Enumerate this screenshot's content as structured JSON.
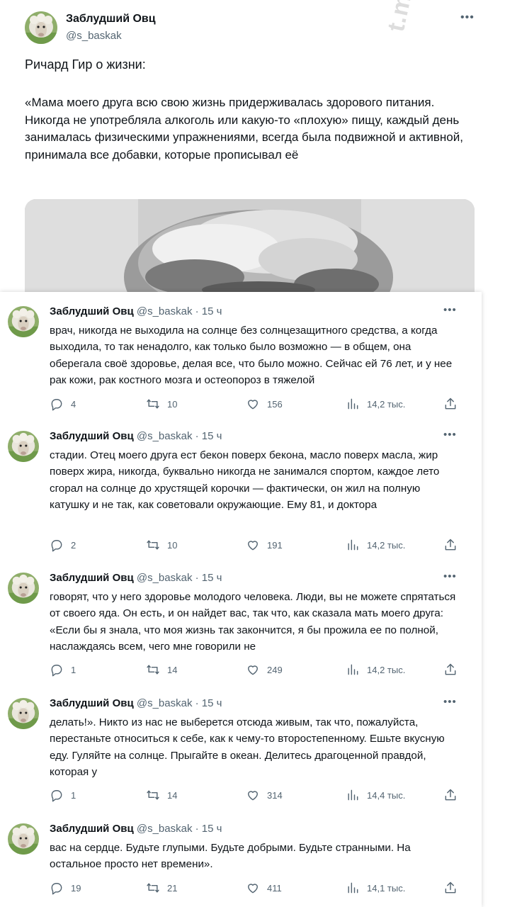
{
  "main_tweet": {
    "author_name": "Заблудший Овц",
    "author_handle": "@s_baskak",
    "more_label": "•••",
    "intro": "Ричард Гир о жизни:",
    "quote": "«Мама моего друга всю свою жизнь придерживалась здорового питания. Никогда не употребляла алкоголь или какую-то «плохую» пищу, каждый день занималась физическими упражнениями, всегда была подвижной и активной, принимала все добавки, которые прописывал её",
    "watermark": "t.me/veravatki"
  },
  "thread": [
    {
      "name": "Заблудший Овц",
      "handle": "@s_baskak",
      "time": "· 15 ч",
      "text": "врач, никогда не выходила на солнце без солнцезащитного средства, а когда выходила, то так ненадолго, как только было возможно — в общем, она оберегала своё здоровье, делая все, что было можно. Сейчас ей 76 лет, и у нее рак кожи, рак костного мозга и остеопороз в тяжелой",
      "replies": "4",
      "retweets": "10",
      "likes": "156",
      "views": "14,2 тыс."
    },
    {
      "name": "Заблудший Овц",
      "handle": "@s_baskak",
      "time": "· 15 ч",
      "text": "стадии. Отец моего друга ест бекон поверх бекона, масло поверх масла, жир поверх жира, никогда, буквально никогда не занимался спортом, каждое лето сгорал на солнце до хрустящей корочки — фактически, он жил на полную катушку и не так, как советовали окружающие. Ему 81, и доктора",
      "replies": "2",
      "retweets": "10",
      "likes": "191",
      "views": "14,2 тыс."
    },
    {
      "name": "Заблудший Овц",
      "handle": "@s_baskak",
      "time": "· 15 ч",
      "text": "говорят, что у него здоровье молодого человека. Люди, вы не можете спрятаться от своего яда. Он есть, и он найдет вас, так что, как сказала мать моего друга: «Если бы я знала, что моя жизнь так закончится, я бы прожила ее по полной, наслаждаясь всем, чего мне говорили не",
      "replies": "1",
      "retweets": "14",
      "likes": "249",
      "views": "14,2 тыс."
    },
    {
      "name": "Заблудший Овц",
      "handle": "@s_baskak",
      "time": "· 15 ч",
      "text": "делать!». Никто из нас не выберется отсюда живым, так что, пожалуйста, перестаньте относиться к себе, как к чему-то второстепенному. Ешьте вкусную еду. Гуляйте на солнце. Прыгайте в океан. Делитесь драгоценной правдой, которая у",
      "replies": "1",
      "retweets": "14",
      "likes": "314",
      "views": "14,4 тыс."
    },
    {
      "name": "Заблудший Овц",
      "handle": "@s_baskak",
      "time": "· 15 ч",
      "text": "вас на сердце. Будьте глупыми. Будьте добрыми. Будьте странными. На остальное просто нет времени».",
      "replies": "19",
      "retweets": "21",
      "likes": "411",
      "views": "14,1 тыс."
    }
  ],
  "icons": {
    "reply": "reply-icon",
    "retweet": "retweet-icon",
    "like": "heart-icon",
    "views": "views-icon",
    "share": "share-icon",
    "more": "more-icon"
  },
  "colors": {
    "text": "#0f1419",
    "secondary": "#536471",
    "background": "#ffffff"
  }
}
